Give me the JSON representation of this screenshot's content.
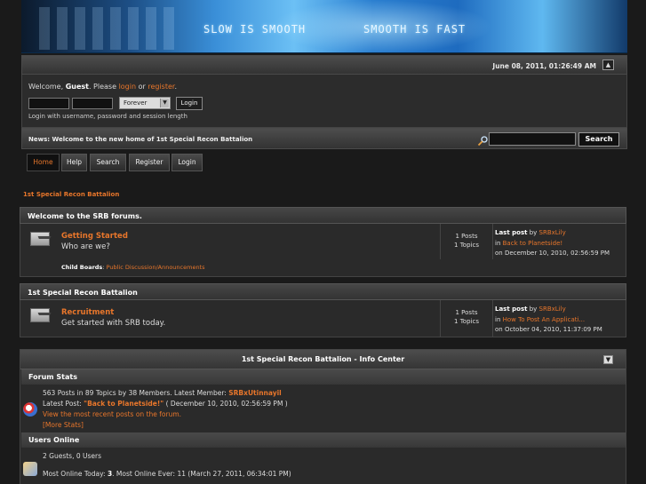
{
  "banner": {
    "slogan_left": "SLOW IS SMOOTH",
    "slogan_right": "SMOOTH IS FAST"
  },
  "topbar": {
    "datetime": "June 08, 2011, 01:26:49 AM"
  },
  "user": {
    "welcome_prefix": "Welcome, ",
    "guest_label": "Guest",
    "please_text": ". Please ",
    "login_link": "login",
    "or_text": " or ",
    "register_link": "register",
    "period": ".",
    "duration_value": "Forever",
    "login_button": "Login",
    "login_hint": "Login with username, password and session length"
  },
  "news": {
    "text": "News: Welcome to the new home of 1st Special Recon Battalion"
  },
  "search": {
    "button": "Search",
    "placeholder": ""
  },
  "nav": {
    "tabs": [
      "Home",
      "Help",
      "Search",
      "Register",
      "Login"
    ]
  },
  "breadcrumb": "1st Special Recon Battalion",
  "categories": [
    {
      "title": "Welcome to the SRB forums.",
      "board": {
        "title": "Getting Started",
        "description": "Who are we?",
        "posts": "1 Posts",
        "topics": "1 Topics",
        "lastpost_label": "Last post",
        "by": "by",
        "author": "SRBxLily",
        "in": "in",
        "topic": "Back to Planetside!",
        "on": "on December 10, 2010, 02:56:59 PM",
        "child_label": "Child Boards",
        "child_board": "Public Discussion/Announcements"
      }
    },
    {
      "title": "1st Special Recon Battalion",
      "board": {
        "title": "Recruitment",
        "description": "Get started with SRB today.",
        "posts": "1 Posts",
        "topics": "1 Topics",
        "lastpost_label": "Last post",
        "by": "by",
        "author": "SRBxLily",
        "in": "in",
        "topic": "How To Post An Applicati...",
        "on": "on October 04, 2010, 11:37:09 PM"
      }
    }
  ],
  "info_center": {
    "title": "1st Special Recon Battalion - Info Center",
    "forum_stats_title": "Forum Stats",
    "stats_line1_prefix": "563 Posts in 89 Topics by 38 Members. Latest Member: ",
    "latest_member": "SRBxUtinnayil",
    "stats_line2_prefix": "Latest Post: ",
    "latest_post": "\"Back to Planetside!\"",
    "stats_line2_suffix": " ( December 10, 2010, 02:56:59 PM )",
    "recent_posts_link": "View the most recent posts on the forum.",
    "more_stats_link": "[More Stats]",
    "users_online_title": "Users Online",
    "users_online_text": "2 Guests, 0 Users",
    "most_online_prefix": "Most Online Today: ",
    "most_online_today": "3",
    "most_online_suffix": ". Most Online Ever: 11 (March 27, 2011, 06:34:01 PM)"
  },
  "colors": {
    "accent": "#e8762b",
    "background": "#1a1a1a",
    "panel": "#2a2a2a"
  }
}
